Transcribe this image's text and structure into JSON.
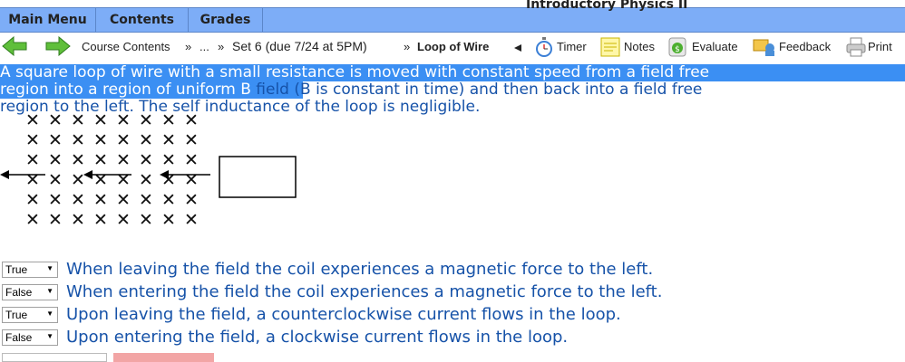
{
  "app": {
    "title": "Introductory Physics II"
  },
  "menu": [
    {
      "label": "Main Menu"
    },
    {
      "label": "Contents"
    },
    {
      "label": "Grades"
    }
  ],
  "nav": {
    "course_contents": "Course Contents",
    "sep1": "»",
    "ellipsis": "...",
    "sep2": "»",
    "set": "Set 6 (due 7/24 at 5PM)",
    "sep3": "»",
    "current": "Loop of Wire",
    "timer": "Timer",
    "notes": "Notes",
    "evaluate": "Evaluate",
    "feedback": "Feedback",
    "print": "Print"
  },
  "problem": {
    "line1": "A square loop of wire with a small resistance is moved with constant speed from a field free",
    "line2a": "region into a region of uniform B",
    "line2b": " field (B is constant in time) and then back into a field free",
    "line3": "region to the left. The self inductance of the loop is negligible."
  },
  "figure": {
    "field_symbol": "✕"
  },
  "answers": [
    {
      "value": "True",
      "statement": "When leaving the field the coil experiences a magnetic force to the left."
    },
    {
      "value": "False",
      "statement": "When entering the field the coil experiences a magnetic force to the left."
    },
    {
      "value": "True",
      "statement": "Upon leaving the field, a counterclockwise current flows in the loop."
    },
    {
      "value": "False",
      "statement": "Upon entering the field, a clockwise current flows in the loop."
    }
  ]
}
